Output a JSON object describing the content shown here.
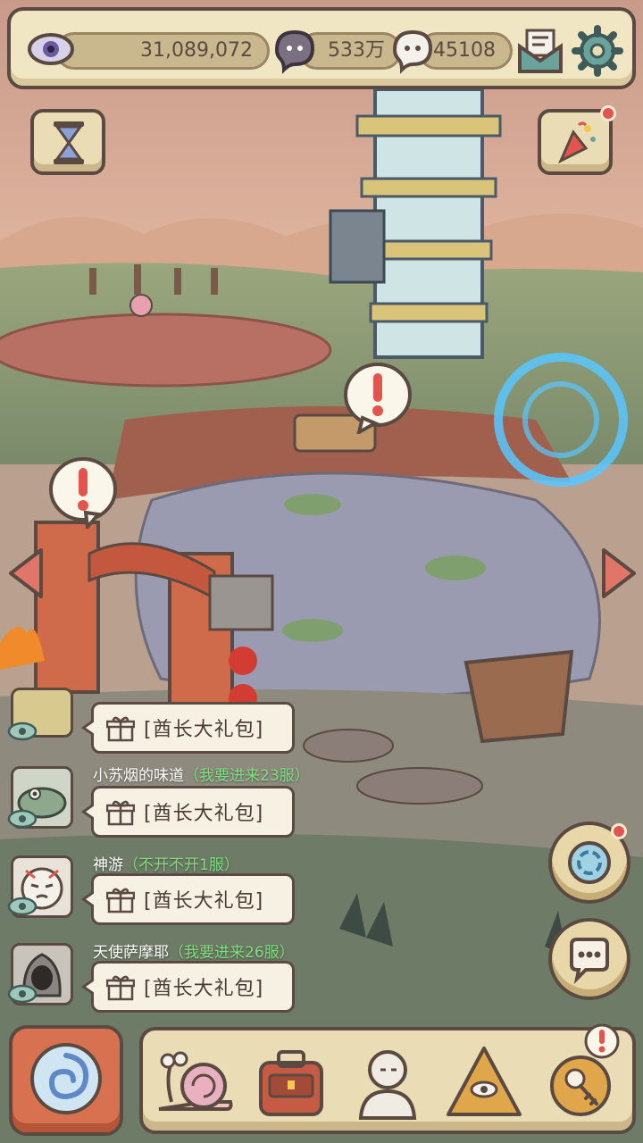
{
  "resources": {
    "eye_count": "31,089,072",
    "soul_count": "533万",
    "ghost_count": "45108"
  },
  "chat": {
    "messages": [
      {
        "name": "",
        "note": "",
        "text": "[酋长大礼包]"
      },
      {
        "name": "小苏烟的味道",
        "note": "（我要进来23服）",
        "text": "[酋长大礼包]"
      },
      {
        "name": "神游",
        "note": "（不开不开1服）",
        "text": "[酋长大礼包]"
      },
      {
        "name": "天使萨摩耶",
        "note": "（我要进来26服）",
        "text": "[酋长大礼包]"
      }
    ]
  },
  "icons": {
    "top": [
      "eye-icon",
      "soul-icon",
      "ghost-icon",
      "mail-icon",
      "gear-icon"
    ],
    "side": [
      "hourglass-icon",
      "party-popper-icon",
      "portal-icon",
      "chat-icon"
    ],
    "bottom": [
      "vortex-icon",
      "snail-icon",
      "backpack-icon",
      "statue-icon",
      "pyramid-eye-icon",
      "key-icon"
    ]
  },
  "colors": {
    "frame": "#5b4a42",
    "panel": "#f1e6c4",
    "accent_red": "#e2554f",
    "chat_note_green": "#7ee07f"
  }
}
